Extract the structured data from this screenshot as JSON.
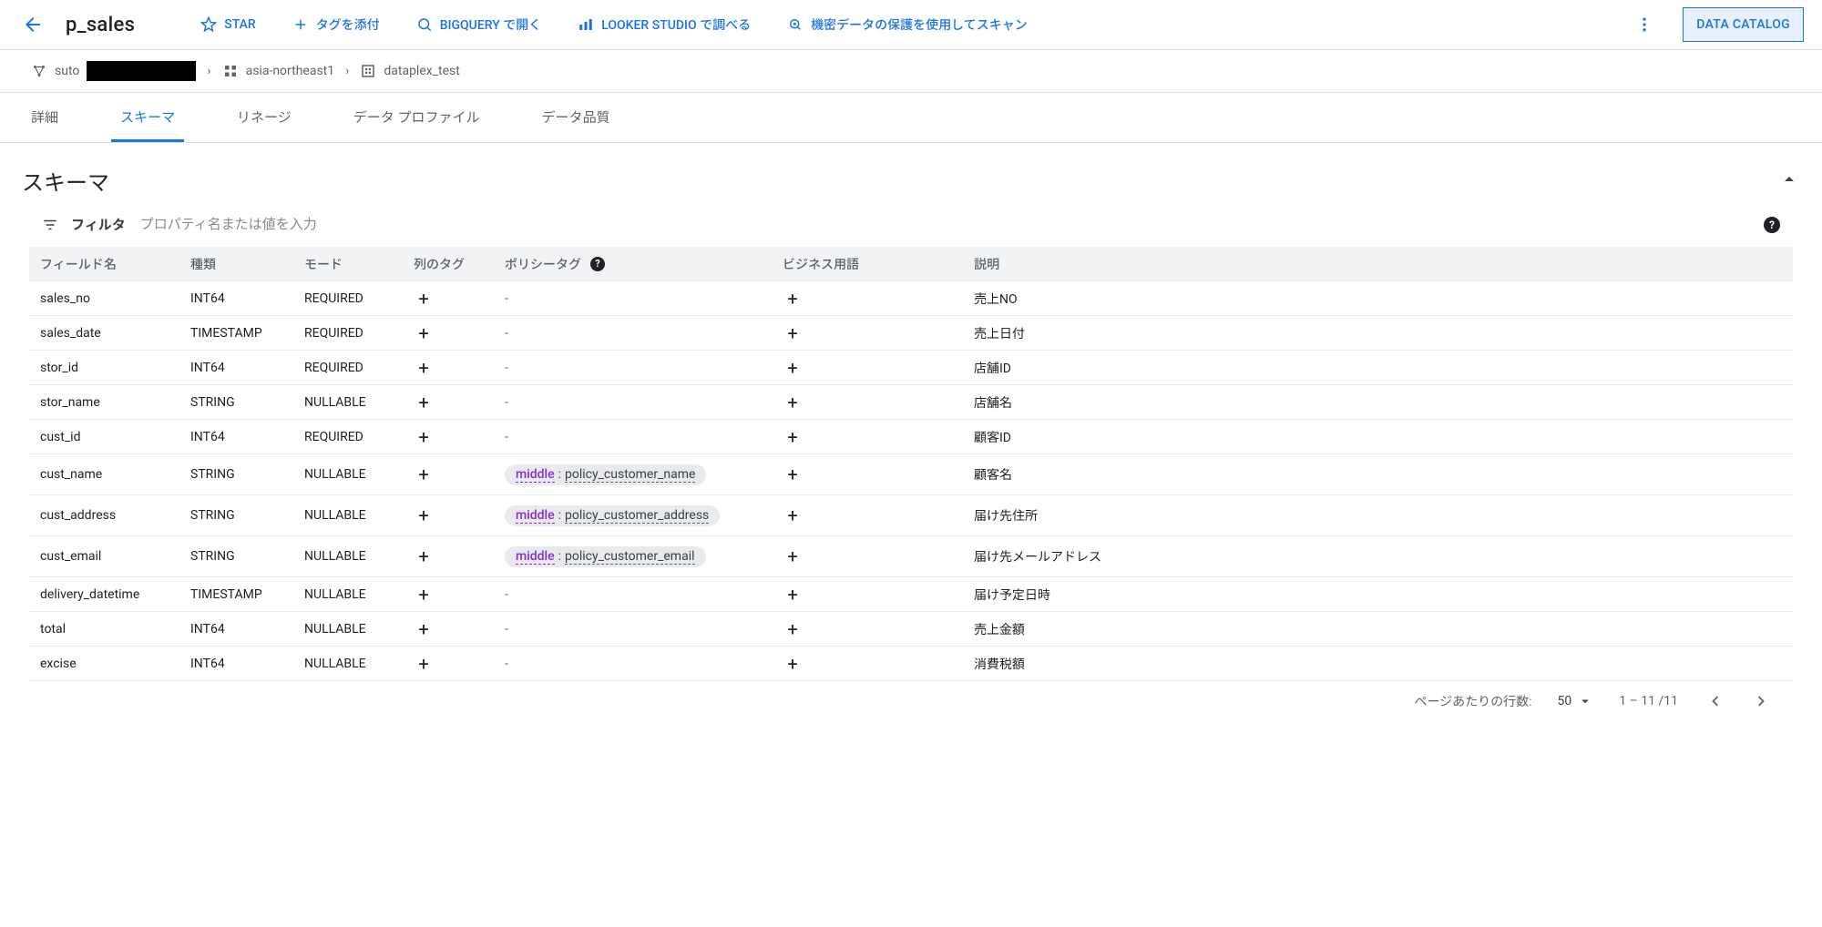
{
  "header": {
    "title": "p_sales",
    "actions": {
      "star": "STAR",
      "add_tag": "タグを添付",
      "open_bq": "BIGQUERY で開く",
      "looker": "LOOKER STUDIO で調べる",
      "scan_sdp": "機密データの保護を使用してスキャン"
    },
    "catalog_btn": "DATA CATALOG"
  },
  "breadcrumb": {
    "prefix": "suto",
    "region": "asia-northeast1",
    "dataset": "dataplex_test"
  },
  "tabs": {
    "detail": "詳細",
    "schema": "スキーマ",
    "lineage": "リネージ",
    "profile": "データ プロファイル",
    "quality": "データ品質"
  },
  "section": {
    "title": "スキーマ",
    "filter_label": "フィルタ",
    "filter_placeholder": "プロパティ名または値を入力"
  },
  "columns": {
    "field": "フィールド名",
    "type": "種類",
    "mode": "モード",
    "coltag": "列のタグ",
    "policy": "ポリシータグ",
    "biz": "ビジネス用語",
    "desc": "説明"
  },
  "rows": [
    {
      "field": "sales_no",
      "type": "INT64",
      "mode": "REQUIRED",
      "policy": null,
      "desc": "売上NO"
    },
    {
      "field": "sales_date",
      "type": "TIMESTAMP",
      "mode": "REQUIRED",
      "policy": null,
      "desc": "売上日付"
    },
    {
      "field": "stor_id",
      "type": "INT64",
      "mode": "REQUIRED",
      "policy": null,
      "desc": "店舗ID"
    },
    {
      "field": "stor_name",
      "type": "STRING",
      "mode": "NULLABLE",
      "policy": null,
      "desc": "店舗名"
    },
    {
      "field": "cust_id",
      "type": "INT64",
      "mode": "REQUIRED",
      "policy": null,
      "desc": "顧客ID"
    },
    {
      "field": "cust_name",
      "type": "STRING",
      "mode": "NULLABLE",
      "policy": {
        "level": "middle",
        "name": "policy_customer_name"
      },
      "desc": "顧客名"
    },
    {
      "field": "cust_address",
      "type": "STRING",
      "mode": "NULLABLE",
      "policy": {
        "level": "middle",
        "name": "policy_customer_address"
      },
      "desc": "届け先住所"
    },
    {
      "field": "cust_email",
      "type": "STRING",
      "mode": "NULLABLE",
      "policy": {
        "level": "middle",
        "name": "policy_customer_email"
      },
      "desc": "届け先メールアドレス"
    },
    {
      "field": "delivery_datetime",
      "type": "TIMESTAMP",
      "mode": "NULLABLE",
      "policy": null,
      "desc": "届け予定日時"
    },
    {
      "field": "total",
      "type": "INT64",
      "mode": "NULLABLE",
      "policy": null,
      "desc": "売上金額"
    },
    {
      "field": "excise",
      "type": "INT64",
      "mode": "NULLABLE",
      "policy": null,
      "desc": "消費税額"
    }
  ],
  "pagination": {
    "rows_label": "ページあたりの行数:",
    "page_size": "50",
    "range": "1 – 11 /11"
  }
}
